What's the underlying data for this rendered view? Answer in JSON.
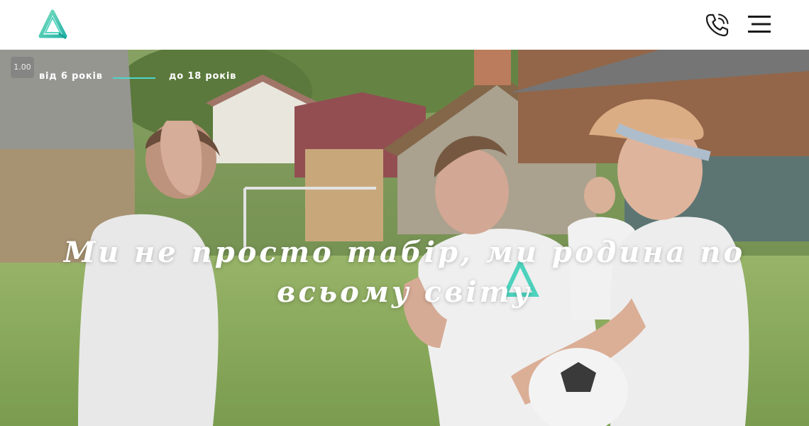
{
  "header": {
    "logo_icon": "triangle-logo-icon",
    "phone_icon": "phone-icon",
    "menu_icon": "hamburger-menu-icon",
    "brand_color": "#3ecfb8"
  },
  "hero": {
    "video_speed": "1.00",
    "age_from": "від 6 років",
    "age_to": "до 18 років",
    "accent_line_color": "#4ed6c8",
    "title": "Ми не просто табір, ми родина по всьому світу"
  }
}
